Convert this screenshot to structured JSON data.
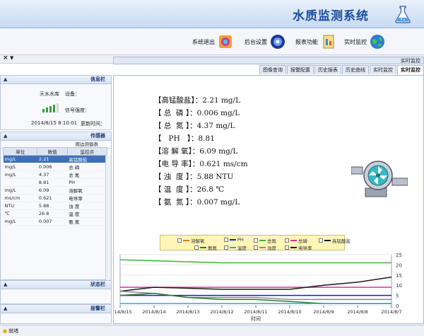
{
  "app": {
    "title": "水质监测系统"
  },
  "toolbar": {
    "realtime": "实时监控",
    "report": "报表功能",
    "settings": "后台设置",
    "exit": "系统退出"
  },
  "tabs": [
    "实时监控",
    "实时监控",
    "历史曲线",
    "历史报表",
    "报警配置",
    "图像查询"
  ],
  "readings": [
    "【高锰酸盐】：2.21 mg/L",
    "【 总  磷 】：0.006 mg/L",
    "【 总  氮 】：4.37 mg/L",
    "【   PH   】：8.81",
    "【溶 解 氧】：6.09 mg/L",
    "【电 导 率】：0.621 ms/cm",
    "【 浊  度 】：5.88 NTU",
    "【 温  度 】：26.8 ℃",
    "【 氨  氮 】：0.007 mg/L"
  ],
  "legend": {
    "row1": [
      "高锰酸盐",
      "总磷",
      "总氮",
      "PH",
      "溶解氧"
    ],
    "row2": [
      "电导率",
      "浊度",
      "温度",
      "氨氮"
    ],
    "colors": [
      "#1a1a1a",
      "#e0309a",
      "#3bb33b",
      "#1a1ad0",
      "#d87a18",
      "#1a1a1a",
      "#888888",
      "#2ea8d6",
      "#2a7a2a"
    ]
  },
  "info_panel": {
    "title": "信息栏",
    "device_label": "设备：",
    "device_value": "天水水库",
    "signal_label": "信号强度：",
    "update_label": "更新时间：",
    "update_value": "2014/8/15 8:10:01"
  },
  "sensor_panel": {
    "title": "传感器",
    "table_title": "周边测值表",
    "columns": [
      "监控点",
      "数值",
      "单位"
    ],
    "rows": [
      [
        "高锰酸盐",
        "2.21",
        "mg/L"
      ],
      [
        "总  磷",
        "0.006",
        "mg/L"
      ],
      [
        "总  氮",
        "4.37",
        "mg/L"
      ],
      [
        "PH",
        "8.81",
        ""
      ],
      [
        "溶解氧",
        "6.09",
        "mg/L"
      ],
      [
        "电导率",
        "0.621",
        "ms/cm"
      ],
      [
        "浊  度",
        "5.88",
        "NTU"
      ],
      [
        "温  度",
        "26.8",
        "℃"
      ],
      [
        "氨  氮",
        "0.007",
        "mg/L"
      ]
    ]
  },
  "status_panel": {
    "title": "状态栏"
  },
  "alarm_panel": {
    "title": "报警栏"
  },
  "statusbar": {
    "text": "就绪"
  },
  "chart_data": {
    "type": "line",
    "x": [
      "2014/8/7",
      "2014/8/8",
      "2014/8/9",
      "2014/8/10",
      "2014/8/11",
      "2014/8/12",
      "2014/8/13",
      "2014/8/14",
      "2014/8/15"
    ],
    "xlabel": "时间",
    "ylabel": "",
    "ylim": [
      0,
      25
    ],
    "yticks": [
      0,
      5,
      10,
      15,
      20,
      25
    ],
    "series": [
      {
        "name": "溶解氧",
        "color": "#3bb33b",
        "values": [
          21,
          21,
          21,
          21,
          21,
          21,
          21.5,
          22,
          22.5
        ]
      },
      {
        "name": "总磷",
        "color": "#e0309a",
        "values": [
          9,
          9,
          9,
          9,
          9,
          9,
          9,
          9,
          9
        ]
      },
      {
        "name": "PH",
        "color": "#1a1ad0",
        "values": [
          5,
          5,
          5,
          5,
          5,
          5,
          5,
          5,
          5
        ]
      },
      {
        "name": "高锰酸盐",
        "color": "#1a1a1a",
        "values": [
          14,
          11.5,
          10,
          8,
          8,
          8,
          8.5,
          9,
          7
        ]
      },
      {
        "name": "浊度",
        "color": "#888888",
        "values": [
          3,
          3,
          3,
          3,
          4,
          4,
          4,
          6,
          7
        ]
      },
      {
        "name": "氨氮",
        "color": "#2a7a2a",
        "values": [
          1,
          1,
          1,
          2,
          3,
          3,
          4,
          6,
          5
        ]
      },
      {
        "name": "温度",
        "color": "#2ea8d6",
        "values": [
          1,
          1,
          1,
          1,
          1,
          1,
          1,
          1,
          1
        ]
      }
    ]
  }
}
